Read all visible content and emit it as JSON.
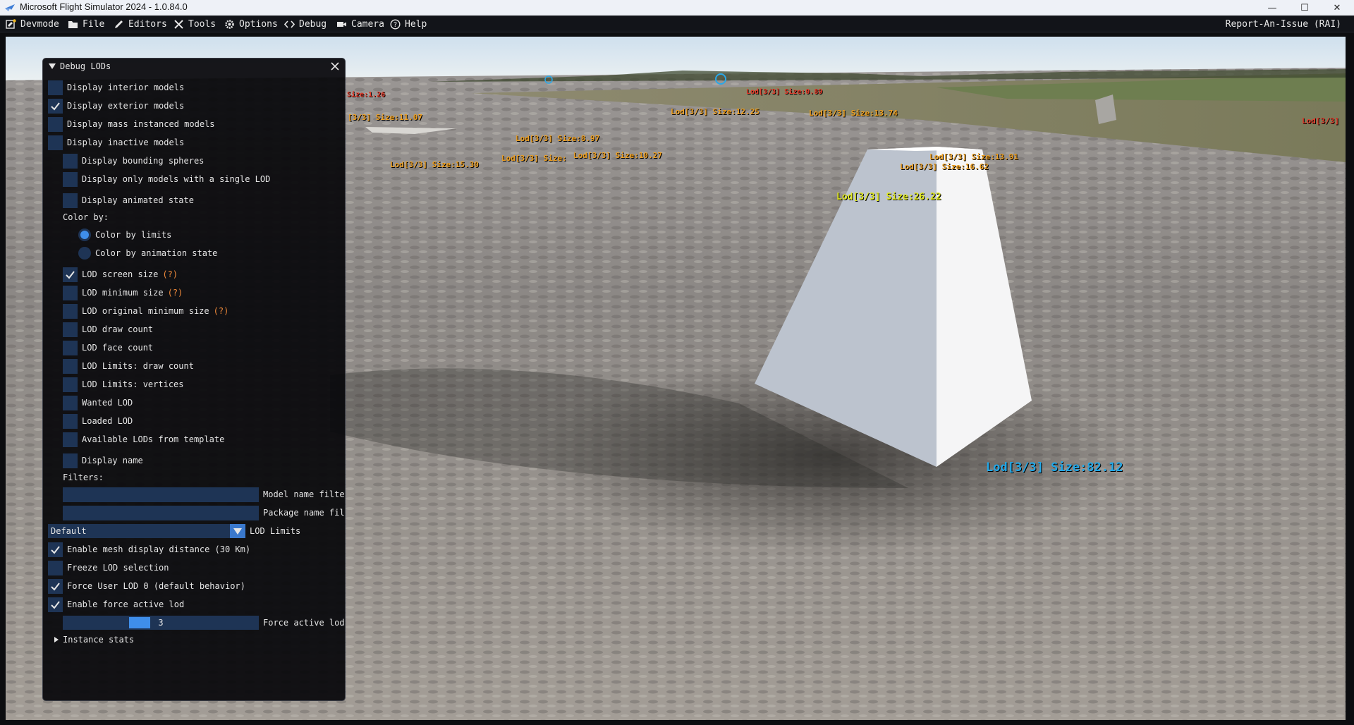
{
  "window": {
    "title": "Microsoft Flight Simulator 2024 - 1.0.84.0",
    "minimize": "—",
    "maximize": "☐",
    "close": "✕"
  },
  "menubar": {
    "items": [
      {
        "label": "Devmode",
        "icon": "devmode-icon"
      },
      {
        "label": "File",
        "icon": "folder-icon"
      },
      {
        "label": "Editors",
        "icon": "pencil-icon"
      },
      {
        "label": "Tools",
        "icon": "tools-icon"
      },
      {
        "label": "Options",
        "icon": "gear-icon"
      },
      {
        "label": "Debug",
        "icon": "code-icon"
      },
      {
        "label": "Camera",
        "icon": "camera-icon"
      },
      {
        "label": "Help",
        "icon": "help-icon"
      }
    ],
    "report_issue": "Report-An-Issue (RAI)"
  },
  "panel": {
    "title": "Debug LODs",
    "display_options": [
      {
        "label": "Display interior models",
        "checked": false
      },
      {
        "label": "Display exterior models",
        "checked": true
      },
      {
        "label": "Display mass instanced models",
        "checked": false
      },
      {
        "label": "Display inactive models",
        "checked": false
      }
    ],
    "sub_options": [
      {
        "label": "Display bounding spheres",
        "checked": false
      },
      {
        "label": "Display only models with a single LOD",
        "checked": false
      },
      {
        "label": "Display animated state",
        "checked": false
      }
    ],
    "color_by_label": "Color by:",
    "color_by": [
      {
        "label": "Color by limits",
        "selected": true
      },
      {
        "label": "Color by animation state",
        "selected": false
      }
    ],
    "lod_options": [
      {
        "label": "LOD screen size",
        "checked": true,
        "help": "(?)"
      },
      {
        "label": "LOD minimum size",
        "checked": false,
        "help": "(?)"
      },
      {
        "label": "LOD original minimum size",
        "checked": false,
        "help": "(?)"
      },
      {
        "label": "LOD draw count",
        "checked": false,
        "help": ""
      },
      {
        "label": "LOD face count",
        "checked": false,
        "help": ""
      },
      {
        "label": "LOD Limits: draw count",
        "checked": false,
        "help": ""
      },
      {
        "label": "LOD Limits: vertices",
        "checked": false,
        "help": ""
      },
      {
        "label": "Wanted LOD",
        "checked": false,
        "help": ""
      },
      {
        "label": "Loaded LOD",
        "checked": false,
        "help": ""
      },
      {
        "label": "Available LODs from template",
        "checked": false,
        "help": ""
      }
    ],
    "display_name": {
      "label": "Display name",
      "checked": false
    },
    "filters_label": "Filters:",
    "model_filter": {
      "value": "",
      "label": "Model name filte"
    },
    "package_filter": {
      "value": "",
      "label": "Package name fil"
    },
    "lod_limits": {
      "value": "Default",
      "label": "LOD Limits"
    },
    "bottom_options": [
      {
        "label": "Enable mesh display distance (30 Km)",
        "checked": true
      },
      {
        "label": "Freeze LOD selection",
        "checked": false
      },
      {
        "label": "Force User LOD 0 (default behavior)",
        "checked": true
      },
      {
        "label": "Enable force active lod",
        "checked": true
      }
    ],
    "force_active_lod": {
      "value": "3",
      "label": "Force active lod"
    },
    "instance_stats": "Instance stats"
  },
  "scene_labels": [
    {
      "text": "Size:1.26",
      "color": "#e53b2a"
    },
    {
      "text": "[3/3] Size:11.07",
      "color": "#f0a020"
    },
    {
      "text": "Lod[3/3] Size:0.89",
      "color": "#e53b2a"
    },
    {
      "text": "Lod[3/3] Size:12.25",
      "color": "#f0a020"
    },
    {
      "text": "Lod[3/3] Size:13.74",
      "color": "#f0a020"
    },
    {
      "text": "Lod[3/3] Size:8.97",
      "color": "#f0a020"
    },
    {
      "text": "Lod[3/3] Size:10.27",
      "color": "#f0a020"
    },
    {
      "text": "Lod[3/3] Size:",
      "color": "#f0a020"
    },
    {
      "text": "Lod[3/3] Size:15.30",
      "color": "#f0a020"
    },
    {
      "text": "Lod[3/3] Size:13.91",
      "color": "#f0a020"
    },
    {
      "text": "Lod[3/3] Size:16.62",
      "color": "#f0a020"
    },
    {
      "text": "Lod[3/3] Size:26.22",
      "color": "#e0e820"
    },
    {
      "text": "Lod[3/3]",
      "color": "#e53b2a"
    },
    {
      "text": "Lod[3/3] Size:82.12",
      "color": "#22a8e8"
    }
  ],
  "colors": {
    "accent": "#3f8eea",
    "frame_bg": "#1e3455",
    "help": "#f08a3a"
  }
}
